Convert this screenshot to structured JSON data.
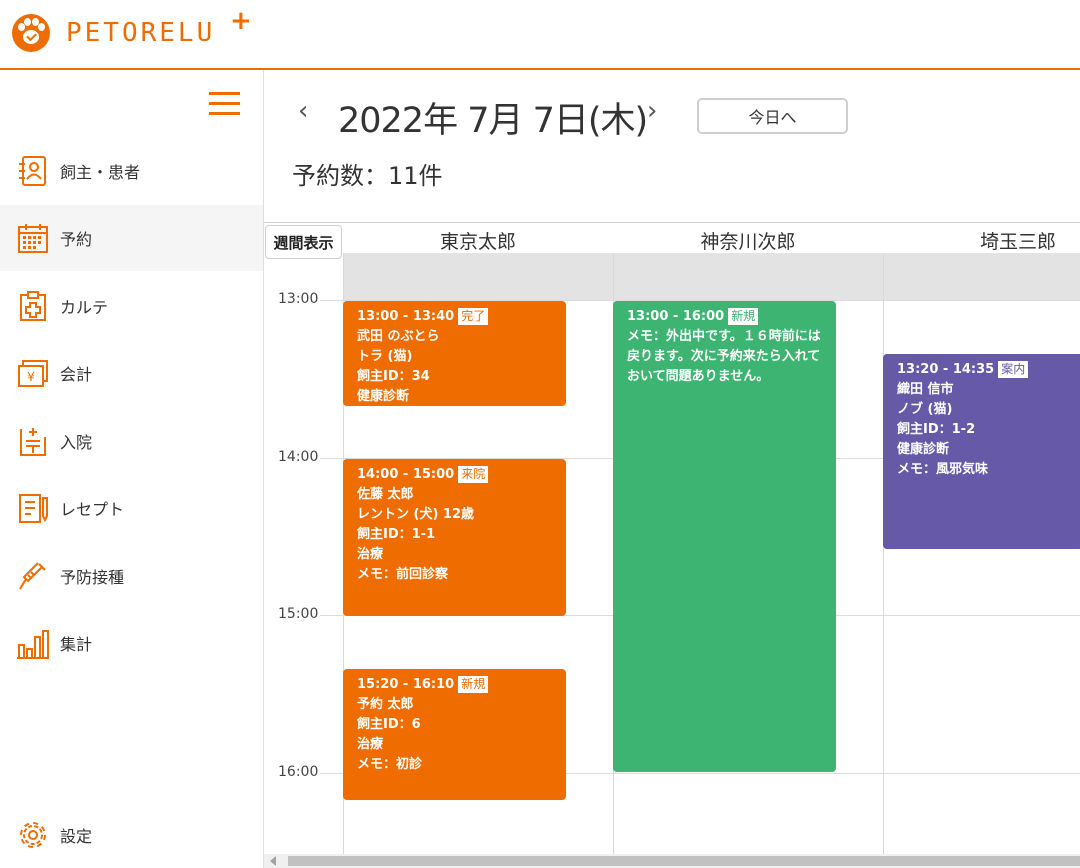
{
  "app": {
    "logo_text": "PETORELU",
    "logo_plus": "+"
  },
  "sidebar": {
    "items": [
      {
        "label": "飼主・患者",
        "icon": "owner-patient-icon"
      },
      {
        "label": "予約",
        "icon": "calendar-icon"
      },
      {
        "label": "カルテ",
        "icon": "medical-chart-icon"
      },
      {
        "label": "会計",
        "icon": "register-icon"
      },
      {
        "label": "入院",
        "icon": "hospitalization-icon"
      },
      {
        "label": "レセプト",
        "icon": "receipt-icon"
      },
      {
        "label": "予防接種",
        "icon": "syringe-icon"
      },
      {
        "label": "集計",
        "icon": "bar-chart-icon"
      }
    ],
    "settings_label": "設定",
    "active_index": 1
  },
  "main": {
    "date_title": "2022年 7月 7日(木)",
    "today_button": "今日へ",
    "count_text": "予約数：11件"
  },
  "calendar": {
    "week_button": "週間表示",
    "columns": [
      "東京太郎",
      "神奈川次郎",
      "埼玉三郎"
    ],
    "times": [
      "13:00",
      "14:00",
      "15:00",
      "16:00"
    ],
    "events": [
      {
        "time": "13:00 - 13:40",
        "badge": "完了",
        "lines": [
          "武田 のぶとら",
          "トラ (猫)",
          "飼主ID：34",
          "健康診断"
        ]
      },
      {
        "time": "14:00 - 15:00",
        "badge": "来院",
        "lines": [
          "佐藤 太郎",
          "レントン (犬) 12歳",
          "飼主ID：1-1",
          "治療",
          "メモ：前回診察"
        ]
      },
      {
        "time": "15:20 - 16:10",
        "badge": "新規",
        "lines": [
          "予約 太郎",
          "飼主ID：6",
          "治療",
          "メモ：初診"
        ]
      },
      {
        "time": "13:00 - 16:00",
        "badge": "新規",
        "memo": "メモ：外出中です。１６時前には戻ります。次に予約来たら入れておいて問題ありません。"
      },
      {
        "time": "13:20 - 14:35",
        "badge": "案内",
        "lines": [
          "織田 信市",
          "ノブ (猫)",
          "飼主ID：1-2",
          "健康診断",
          "メモ：風邪気味"
        ]
      }
    ]
  },
  "colors": {
    "accent": "#ee6c00",
    "green": "#3db471",
    "purple": "#6559a8"
  }
}
